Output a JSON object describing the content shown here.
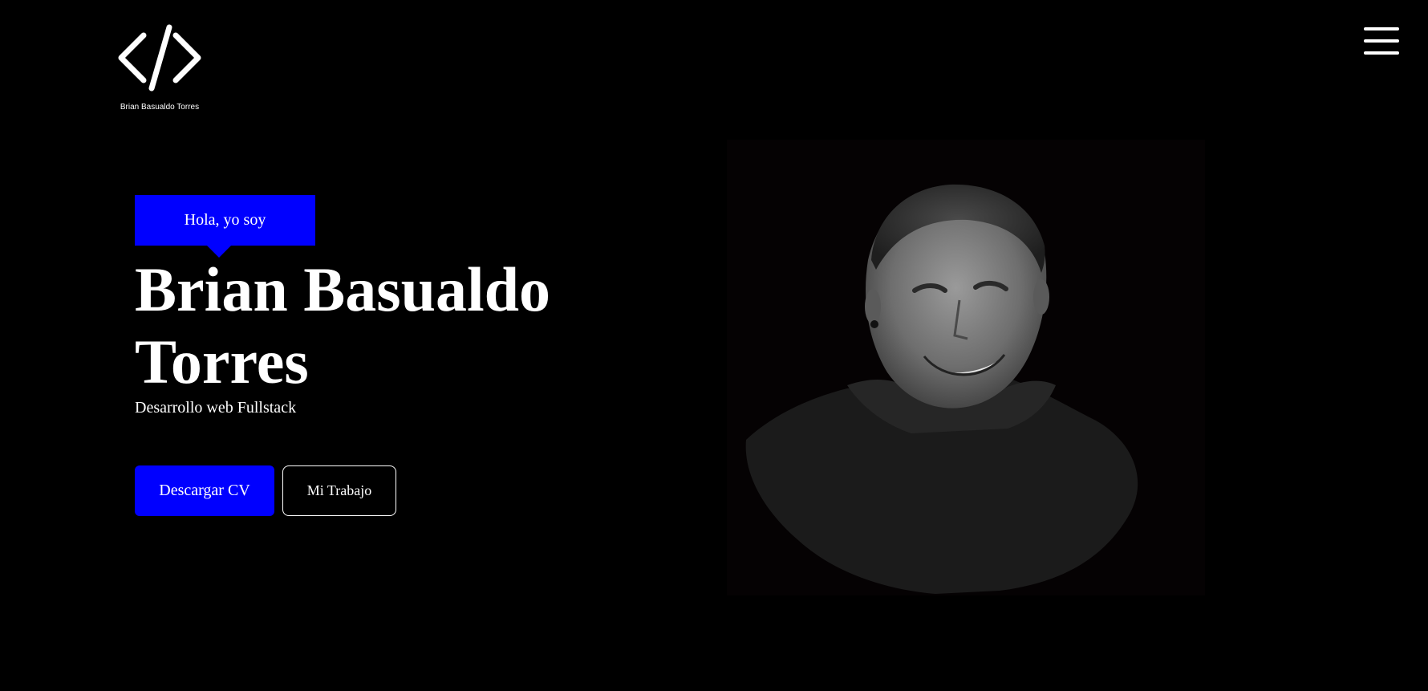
{
  "header": {
    "logo_caption": "Brian Basualdo Torres",
    "logo_icon": "code-brackets-icon",
    "menu_icon": "hamburger-menu-icon"
  },
  "hero": {
    "greeting": "Hola, yo soy",
    "name": "Brian Basualdo Torres",
    "role": "Desarrollo web Fullstack",
    "download_cv_label": "Descargar CV",
    "my_work_label": "Mi Trabajo"
  },
  "colors": {
    "background": "#000000",
    "accent": "#0000ff",
    "text": "#ffffff"
  }
}
